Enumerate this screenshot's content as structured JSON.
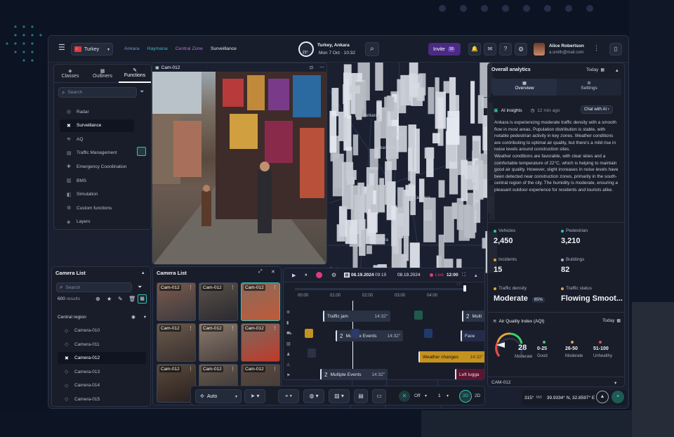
{
  "topbar": {
    "country": "Turkey",
    "breadcrumbs": [
      "Ankara",
      "Haymana",
      "Central Zone",
      "Surveillance"
    ],
    "weather_badge": "21°",
    "location": "Turkey, Ankara",
    "datetime": "Mon 7 Oct  ·  10:32",
    "invite_label": "Invite",
    "invite_count": "16",
    "user_name": "Alice Robertson",
    "user_email": "a.smith@mail.com"
  },
  "left_panel": {
    "tabs": [
      "Classes",
      "Outliners",
      "Functions"
    ],
    "active_tab": "Functions",
    "search_placeholder": "Search",
    "items": [
      {
        "label": "Radar",
        "icon": "radar-icon"
      },
      {
        "label": "Surveillance",
        "icon": "surveillance-icon"
      },
      {
        "label": "AQ",
        "icon": "air-quality-icon"
      },
      {
        "label": "Traffic Management",
        "icon": "traffic-icon"
      },
      {
        "label": "Emergency Coordination",
        "icon": "emergency-icon"
      },
      {
        "label": "BMS",
        "icon": "bms-icon"
      },
      {
        "label": "Simulation",
        "icon": "simulation-icon"
      },
      {
        "label": "Custom functions",
        "icon": "custom-functions-icon"
      },
      {
        "label": "Layers",
        "icon": "layers-icon"
      }
    ]
  },
  "camera_feed": {
    "title": "Cam-012"
  },
  "camera_list_panel": {
    "title": "Camera List",
    "search_placeholder": "Search",
    "results": "600",
    "results_label": "results",
    "region": "Central region",
    "cameras": [
      "Camera-010",
      "Camera-011",
      "Camera-012",
      "Camera-013",
      "Camera-014",
      "Camera-015"
    ]
  },
  "camera_grid": {
    "title": "Camera List",
    "tiles": [
      "Cam-012",
      "Cam-012",
      "Cam-012",
      "Cam-012",
      "Cam-012",
      "Cam-012",
      "Cam-012",
      "Cam-012",
      "Cam-012"
    ]
  },
  "timeline": {
    "start_date": "08.19.2024",
    "start_time": "09:19",
    "end_date": "08.19.2024",
    "live_label": "Live",
    "live_time": "12:00",
    "ticks": [
      "00:00",
      "01:00",
      "02:00",
      "03:00",
      "04:00"
    ],
    "events": [
      {
        "label": "Traffic jam",
        "time": "14:32\""
      },
      {
        "label": "Multi",
        "count": "2"
      },
      {
        "label": "Multiple Events",
        "count": "2",
        "time": "14:32\""
      },
      {
        "label": "Face",
        "time": ""
      },
      {
        "label": "Weather changes",
        "time": "14:32\""
      },
      {
        "label": "Multiple Events",
        "count": "2",
        "time": "14:32\""
      },
      {
        "label": "Left lugga",
        "time": ""
      }
    ]
  },
  "bottom_toolbar": {
    "mode": "Auto",
    "off_label": "Off",
    "count": "1",
    "view_3d": "3D",
    "view_2d": "2D",
    "heading": "315°",
    "heading_dir": "NW",
    "coords": "39.9334° N, 32.8597° E"
  },
  "map_labels": [
    "Ankara",
    "Ankara Hotels",
    "Ankara",
    "Cankaya",
    "Ankara",
    "Cuphane"
  ],
  "analytics": {
    "title": "Overall analytics",
    "period": "Today",
    "tabs": [
      "Overview",
      "Settings"
    ],
    "ai_title": "AI insights",
    "ai_time": "12 min ago",
    "chat_label": "Chat with AI",
    "paragraph1": "Ankara is experiencing moderate traffic density with a smooth flow in most areas. Population distribution is stable, with notable pedestrian activity in key zones. Weather conditions are contributing to optimal air quality, but there's a mild rise in noise levels around construction sites.",
    "paragraph2": "Weather conditions are favorable, with clear skies and a comfortable temperature of 22°C, which is helping to maintain good air quality. However, slight increases in noise levels have been detected near construction zones, primarily in the south-central region of the city. The humidity is moderate, ensuring a pleasant outdoor experience for residents and tourists alike.",
    "metrics": [
      {
        "label": "Vehicles",
        "value": "2,450",
        "color": "#2ec4b6"
      },
      {
        "label": "Pedestrian",
        "value": "3,210",
        "color": "#2ec4b6"
      },
      {
        "label": "Incidents",
        "value": "15",
        "color": "#e8a23a"
      },
      {
        "label": "Buildings",
        "value": "82",
        "color": "#aab3c2"
      },
      {
        "label": "Traffic density",
        "value": "Moderate",
        "badge": "65%",
        "color": "#e8a23a"
      },
      {
        "label": "Traffic status",
        "value": "Flowing Smoot...",
        "color": "#e8a23a"
      }
    ],
    "aqi_title": "Air Quality Index (AQI)",
    "aqi_period": "Today",
    "aqi_value": "28",
    "aqi_status": "Moderate",
    "aqi_ranges": [
      {
        "range": "0-25",
        "label": "Good",
        "color": "#3ccf6a"
      },
      {
        "range": "26-50",
        "label": "Moderate",
        "color": "#e8a23a"
      },
      {
        "range": "51-100",
        "label": "Unhealthy",
        "color": "#e84a4a"
      }
    ],
    "footer_cam": "CAM-012"
  }
}
